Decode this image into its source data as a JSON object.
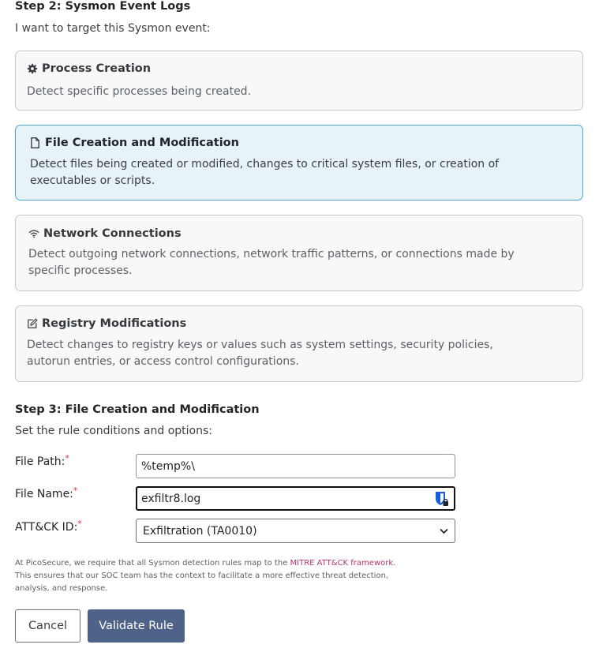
{
  "step2": {
    "title": "Step 2: Sysmon Event Logs",
    "subtitle": "I want to target this Sysmon event:"
  },
  "events": [
    {
      "title": "Process Creation",
      "description": "Detect specific processes being created.",
      "icon": "gear-icon",
      "selected": false
    },
    {
      "title": "File Creation and Modification",
      "description": "Detect files being created or modified, changes to critical system files, or creation of executables or scripts.",
      "icon": "file-icon",
      "selected": true
    },
    {
      "title": "Network Connections",
      "description": "Detect outgoing network connections, network traffic patterns, or connections made by specific processes.",
      "icon": "wifi-icon",
      "selected": false
    },
    {
      "title": "Registry Modifications",
      "description": "Detect changes to registry keys or values such as system settings, security policies, autorun entries, or access control configurations.",
      "icon": "edit-icon",
      "selected": false
    }
  ],
  "step3": {
    "title": "Step 3: File Creation and Modification",
    "subtitle": "Set the rule conditions and options:"
  },
  "form": {
    "file_path_label": "File Path:",
    "file_path_value": "%temp%\\",
    "file_name_label": "File Name:",
    "file_name_value": "exfiltr8.log",
    "attack_label": "ATT&CK ID:",
    "attack_value": "Exfiltration (TA0010)",
    "required_marker": "*"
  },
  "note": {
    "before_link": "At PicoSecure, we require that all Sysmon detection rules map to the ",
    "link_text": "MITRE ATT&CK framework",
    "after_link": ". This ensures that our SOC team has the context to facilitate a more effective threat detection, analysis, and response."
  },
  "buttons": {
    "cancel": "Cancel",
    "validate": "Validate Rule"
  },
  "colors": {
    "selected_card_bg": "#e8f3f9",
    "selected_card_border": "#49a8d8",
    "primary_button": "#4f6288",
    "link": "#b8336a",
    "required": "#d9363e"
  }
}
